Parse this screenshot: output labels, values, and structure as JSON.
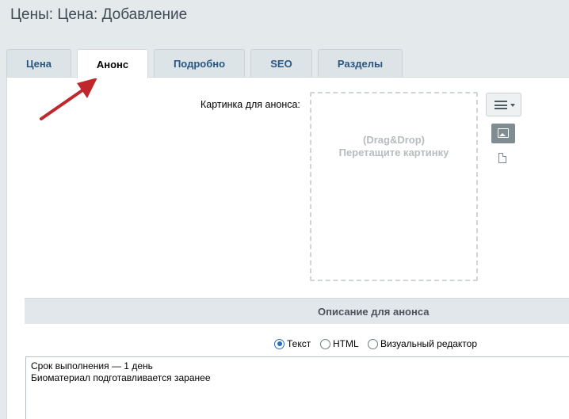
{
  "page": {
    "title": "Цены: Цена: Добавление"
  },
  "tabs": [
    {
      "label": "Цена",
      "active": false
    },
    {
      "label": "Анонс",
      "active": true
    },
    {
      "label": "Подробно",
      "active": false
    },
    {
      "label": "SEO",
      "active": false
    },
    {
      "label": "Разделы",
      "active": false
    }
  ],
  "preview_image": {
    "label": "Картинка для анонса:",
    "drop_line1": "(Drag&Drop)",
    "drop_line2": "Перетащите картинку"
  },
  "icons": {
    "menu": "menu-icon",
    "image": "image-icon",
    "file": "file-icon",
    "arrow": "arrow-annotation"
  },
  "description": {
    "header": "Описание для анонса",
    "formats": [
      {
        "label": "Текст",
        "selected": true
      },
      {
        "label": "HTML",
        "selected": false
      },
      {
        "label": "Визуальный редактор",
        "selected": false
      }
    ],
    "lines": [
      "Срок выполнения — 1 день",
      "Биоматериал подготавливается заранее"
    ]
  },
  "colors": {
    "background": "#e4e9eb",
    "tab_text": "#295682",
    "arrow": "#c0272d",
    "radio_accent": "#2c6eb5"
  }
}
